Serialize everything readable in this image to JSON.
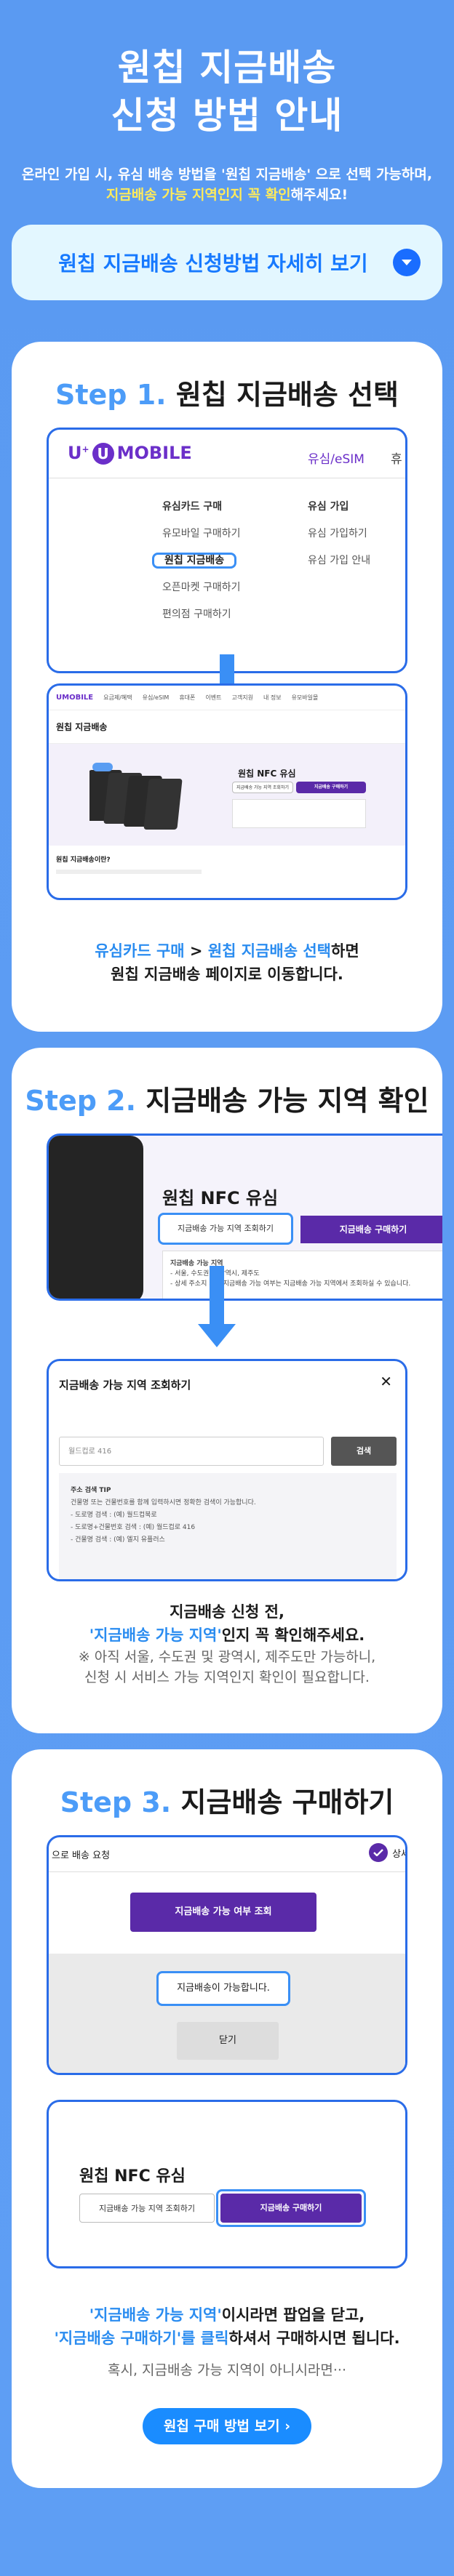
{
  "hero": {
    "title_line1": "원칩 지금배송",
    "title_line2": "신청 방법 안내",
    "sub1": "온라인 가입 시, 유심 배송 방법을 '원칩 지금배송' 으로 선택 가능하며,",
    "sub2_highlight": "지금배송 가능 지역인지 꼭 확인",
    "sub2_rest": "해주세요!",
    "toggle_label": "원칩 지금배송 신청방법 자세히 보기"
  },
  "step1": {
    "num": "Step 1.",
    "title": "원칩 지금배송 선택",
    "logo_u": "U",
    "logo_text": "MOBILE",
    "tab_usim": "유심/eSIM",
    "tab_cut": "휴",
    "menu1_head": "유심카드 구매",
    "menu1_items": [
      "유모바일 구매하기",
      "원칩 지금배송",
      "오픈마켓 구매하기",
      "편의점 구매하기"
    ],
    "menu2_head": "유심 가입",
    "menu2_items": [
      "유심 가입하기",
      "유심 가입 안내"
    ],
    "mini_nav": [
      "요금제/혜택",
      "유심/eSIM",
      "휴대폰",
      "이벤트",
      "고객지원",
      "내 정보",
      "유모바일몰"
    ],
    "mini_title": "원칩 지금배송",
    "mini_product": "원칩 NFC 유심",
    "mini_btn1": "지금배송 가능 지역 조회하기",
    "mini_btn2": "지금배송 구매하기",
    "mini_section": "원칩 지금배송이란?",
    "cap_a": "유심카드 구매",
    "cap_b": " > ",
    "cap_c": "원칩 지금배송 선택",
    "cap_d": "하면",
    "cap_line2": "원칩 지금배송 페이지로 이동합니다."
  },
  "step2": {
    "num": "Step 2.",
    "title": "지금배송 가능 지역 확인",
    "product": "원칩 NFC 유심",
    "btn_check": "지금배송 가능 지역 조회하기",
    "btn_buy": "지금배송 구매하기",
    "info_head": "지금배송 가능 지역",
    "info_1": "- 서울, 수도권 및 광역시, 제주도",
    "info_2": "- 상세 주소지 기준 지금배송 가능 여부는 지금배송 가능 지역에서 조회하실 수 있습니다.",
    "popup_title": "지금배송 가능 지역 조회하기",
    "popup_close": "✕",
    "popup_placeholder": "월드컵로 416",
    "popup_search": "검색",
    "tip_head": "주소 검색 TIP",
    "tip_1": "건물명 또는 건물번호를 함께 입력하시면 정확한 검색이 가능합니다.",
    "tip_2": "- 도로명 검색 : (예) 월드컵북로",
    "tip_3": "- 도로명+건물번호 검색 : (예) 월드컵로 416",
    "tip_4": "- 건물명 검색 : (예) 엘지 유플러스",
    "cap_line1": "지금배송 신청 전,",
    "cap_line2_hl": "'지금배송 가능 지역'",
    "cap_line2_rest": "인지 꼭 확인해주세요.",
    "cap_line3": "※ 아직 서울, 수도권 및 광역시, 제주도만 가능하니,",
    "cap_line4": "신청 시 서비스 가능 지역인지 확인이 필요합니다."
  },
  "step3": {
    "num": "Step 3.",
    "title": "지금배송 구매하기",
    "top_left": "으로 배송 요청",
    "top_right": "상세",
    "btn_query": "지금배송 가능 여부 조회",
    "available": "지금배송이 가능합니다.",
    "close": "닫기",
    "product": "원칩 NFC 유심",
    "btn_check": "지금배송 가능 지역 조회하기",
    "btn_buy": "지금배송 구매하기",
    "cap_hl1": "'지금배송 가능 지역'",
    "cap_rest1": "이시라면 팝업을 닫고,",
    "cap_hl2": "'지금배송 구매하기'를 클릭",
    "cap_rest2": "하셔서 구매하시면 됩니다.",
    "cap_line3": "혹시, 지금배송 가능 지역이 아니시라면···",
    "final_btn": "원칩 구매 방법 보기 ›"
  }
}
